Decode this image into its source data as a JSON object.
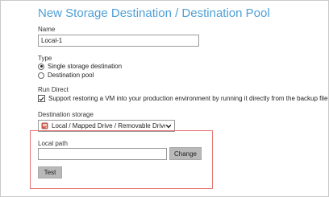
{
  "page": {
    "title": "New Storage Destination / Destination Pool"
  },
  "name_field": {
    "label": "Name",
    "value": "Local-1"
  },
  "type": {
    "label": "Type",
    "options": [
      {
        "label": "Single storage destination",
        "selected": true
      },
      {
        "label": "Destination pool",
        "selected": false
      }
    ]
  },
  "run_direct": {
    "label": "Run Direct",
    "checkbox_label": "Support restoring a VM into your production environment by running it directly from the backup file",
    "checked": true
  },
  "destination_storage": {
    "label": "Destination storage",
    "selected": "Local / Mapped Drive / Removable Drive",
    "icon": "drive-icon"
  },
  "local_path": {
    "label": "Local path",
    "value": "",
    "change_label": "Change",
    "test_label": "Test"
  },
  "colors": {
    "title": "#4f9fd6",
    "highlight_border": "#e57373",
    "button_bg": "#b9b9b9"
  }
}
